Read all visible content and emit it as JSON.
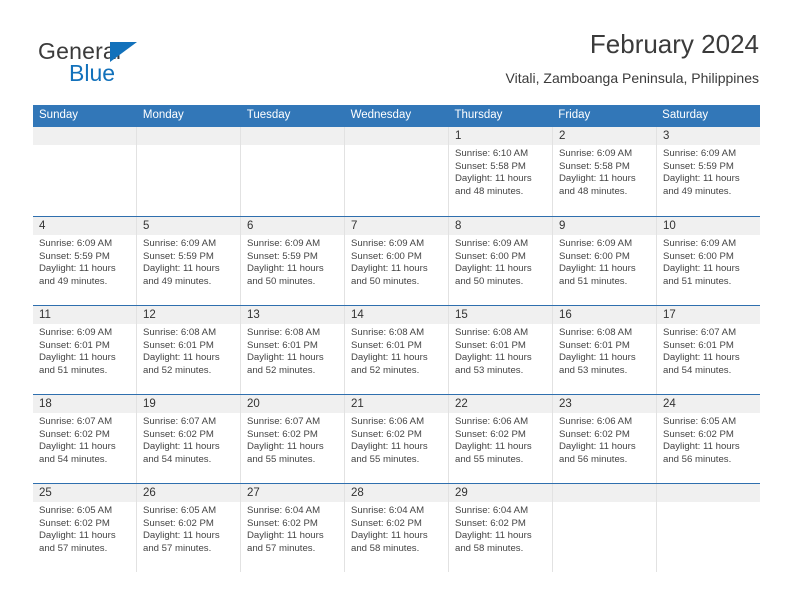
{
  "logo": {
    "word_one": "General",
    "word_two": "Blue",
    "triangle_color": "#1271bb",
    "text_color": "#3b3b3b"
  },
  "header": {
    "title": "February 2024",
    "subtitle": "Vitali, Zamboanga Peninsula, Philippines"
  },
  "theme": {
    "header_blue": "#3277b8",
    "row_divider_blue": "#2f6fae",
    "daynum_band": "#f0f0f0",
    "cell_divider": "#e2e2e2"
  },
  "weekdays": [
    "Sunday",
    "Monday",
    "Tuesday",
    "Wednesday",
    "Thursday",
    "Friday",
    "Saturday"
  ],
  "labels": {
    "sunrise_prefix": "Sunrise:",
    "sunset_prefix": "Sunset:",
    "daylight_prefix": "Daylight:"
  },
  "weeks": [
    [
      {
        "day": "",
        "empty": true
      },
      {
        "day": "",
        "empty": true
      },
      {
        "day": "",
        "empty": true
      },
      {
        "day": "",
        "empty": true
      },
      {
        "day": "1",
        "sunrise": "Sunrise: 6:10 AM",
        "sunset": "Sunset: 5:58 PM",
        "daylight_line1": "Daylight: 11 hours",
        "daylight_line2": "and 48 minutes."
      },
      {
        "day": "2",
        "sunrise": "Sunrise: 6:09 AM",
        "sunset": "Sunset: 5:58 PM",
        "daylight_line1": "Daylight: 11 hours",
        "daylight_line2": "and 48 minutes."
      },
      {
        "day": "3",
        "sunrise": "Sunrise: 6:09 AM",
        "sunset": "Sunset: 5:59 PM",
        "daylight_line1": "Daylight: 11 hours",
        "daylight_line2": "and 49 minutes."
      }
    ],
    [
      {
        "day": "4",
        "sunrise": "Sunrise: 6:09 AM",
        "sunset": "Sunset: 5:59 PM",
        "daylight_line1": "Daylight: 11 hours",
        "daylight_line2": "and 49 minutes."
      },
      {
        "day": "5",
        "sunrise": "Sunrise: 6:09 AM",
        "sunset": "Sunset: 5:59 PM",
        "daylight_line1": "Daylight: 11 hours",
        "daylight_line2": "and 49 minutes."
      },
      {
        "day": "6",
        "sunrise": "Sunrise: 6:09 AM",
        "sunset": "Sunset: 5:59 PM",
        "daylight_line1": "Daylight: 11 hours",
        "daylight_line2": "and 50 minutes."
      },
      {
        "day": "7",
        "sunrise": "Sunrise: 6:09 AM",
        "sunset": "Sunset: 6:00 PM",
        "daylight_line1": "Daylight: 11 hours",
        "daylight_line2": "and 50 minutes."
      },
      {
        "day": "8",
        "sunrise": "Sunrise: 6:09 AM",
        "sunset": "Sunset: 6:00 PM",
        "daylight_line1": "Daylight: 11 hours",
        "daylight_line2": "and 50 minutes."
      },
      {
        "day": "9",
        "sunrise": "Sunrise: 6:09 AM",
        "sunset": "Sunset: 6:00 PM",
        "daylight_line1": "Daylight: 11 hours",
        "daylight_line2": "and 51 minutes."
      },
      {
        "day": "10",
        "sunrise": "Sunrise: 6:09 AM",
        "sunset": "Sunset: 6:00 PM",
        "daylight_line1": "Daylight: 11 hours",
        "daylight_line2": "and 51 minutes."
      }
    ],
    [
      {
        "day": "11",
        "sunrise": "Sunrise: 6:09 AM",
        "sunset": "Sunset: 6:01 PM",
        "daylight_line1": "Daylight: 11 hours",
        "daylight_line2": "and 51 minutes."
      },
      {
        "day": "12",
        "sunrise": "Sunrise: 6:08 AM",
        "sunset": "Sunset: 6:01 PM",
        "daylight_line1": "Daylight: 11 hours",
        "daylight_line2": "and 52 minutes."
      },
      {
        "day": "13",
        "sunrise": "Sunrise: 6:08 AM",
        "sunset": "Sunset: 6:01 PM",
        "daylight_line1": "Daylight: 11 hours",
        "daylight_line2": "and 52 minutes."
      },
      {
        "day": "14",
        "sunrise": "Sunrise: 6:08 AM",
        "sunset": "Sunset: 6:01 PM",
        "daylight_line1": "Daylight: 11 hours",
        "daylight_line2": "and 52 minutes."
      },
      {
        "day": "15",
        "sunrise": "Sunrise: 6:08 AM",
        "sunset": "Sunset: 6:01 PM",
        "daylight_line1": "Daylight: 11 hours",
        "daylight_line2": "and 53 minutes."
      },
      {
        "day": "16",
        "sunrise": "Sunrise: 6:08 AM",
        "sunset": "Sunset: 6:01 PM",
        "daylight_line1": "Daylight: 11 hours",
        "daylight_line2": "and 53 minutes."
      },
      {
        "day": "17",
        "sunrise": "Sunrise: 6:07 AM",
        "sunset": "Sunset: 6:01 PM",
        "daylight_line1": "Daylight: 11 hours",
        "daylight_line2": "and 54 minutes."
      }
    ],
    [
      {
        "day": "18",
        "sunrise": "Sunrise: 6:07 AM",
        "sunset": "Sunset: 6:02 PM",
        "daylight_line1": "Daylight: 11 hours",
        "daylight_line2": "and 54 minutes."
      },
      {
        "day": "19",
        "sunrise": "Sunrise: 6:07 AM",
        "sunset": "Sunset: 6:02 PM",
        "daylight_line1": "Daylight: 11 hours",
        "daylight_line2": "and 54 minutes."
      },
      {
        "day": "20",
        "sunrise": "Sunrise: 6:07 AM",
        "sunset": "Sunset: 6:02 PM",
        "daylight_line1": "Daylight: 11 hours",
        "daylight_line2": "and 55 minutes."
      },
      {
        "day": "21",
        "sunrise": "Sunrise: 6:06 AM",
        "sunset": "Sunset: 6:02 PM",
        "daylight_line1": "Daylight: 11 hours",
        "daylight_line2": "and 55 minutes."
      },
      {
        "day": "22",
        "sunrise": "Sunrise: 6:06 AM",
        "sunset": "Sunset: 6:02 PM",
        "daylight_line1": "Daylight: 11 hours",
        "daylight_line2": "and 55 minutes."
      },
      {
        "day": "23",
        "sunrise": "Sunrise: 6:06 AM",
        "sunset": "Sunset: 6:02 PM",
        "daylight_line1": "Daylight: 11 hours",
        "daylight_line2": "and 56 minutes."
      },
      {
        "day": "24",
        "sunrise": "Sunrise: 6:05 AM",
        "sunset": "Sunset: 6:02 PM",
        "daylight_line1": "Daylight: 11 hours",
        "daylight_line2": "and 56 minutes."
      }
    ],
    [
      {
        "day": "25",
        "sunrise": "Sunrise: 6:05 AM",
        "sunset": "Sunset: 6:02 PM",
        "daylight_line1": "Daylight: 11 hours",
        "daylight_line2": "and 57 minutes."
      },
      {
        "day": "26",
        "sunrise": "Sunrise: 6:05 AM",
        "sunset": "Sunset: 6:02 PM",
        "daylight_line1": "Daylight: 11 hours",
        "daylight_line2": "and 57 minutes."
      },
      {
        "day": "27",
        "sunrise": "Sunrise: 6:04 AM",
        "sunset": "Sunset: 6:02 PM",
        "daylight_line1": "Daylight: 11 hours",
        "daylight_line2": "and 57 minutes."
      },
      {
        "day": "28",
        "sunrise": "Sunrise: 6:04 AM",
        "sunset": "Sunset: 6:02 PM",
        "daylight_line1": "Daylight: 11 hours",
        "daylight_line2": "and 58 minutes."
      },
      {
        "day": "29",
        "sunrise": "Sunrise: 6:04 AM",
        "sunset": "Sunset: 6:02 PM",
        "daylight_line1": "Daylight: 11 hours",
        "daylight_line2": "and 58 minutes."
      },
      {
        "day": "",
        "empty": true
      },
      {
        "day": "",
        "empty": true
      }
    ]
  ]
}
